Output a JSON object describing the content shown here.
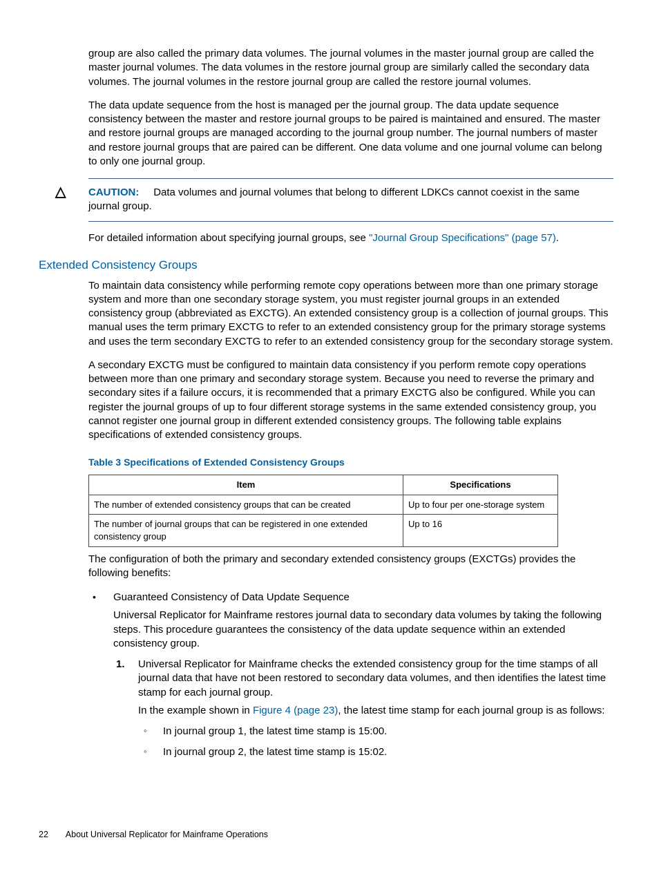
{
  "para": {
    "p1": "group are also called the primary data volumes. The journal volumes in the master journal group are called the master journal volumes. The data volumes in the restore journal group are similarly called the secondary data volumes. The journal volumes in the restore journal group are called the restore journal volumes.",
    "p2": "The data update sequence from the host is managed per the journal group. The data update sequence consistency between the master and restore journal groups to be paired is maintained and ensured. The master and restore journal groups are managed according to the journal group number. The journal numbers of master and restore journal groups that are paired can be different. One data volume and one journal volume can belong to only one journal group."
  },
  "caution": {
    "label": "CAUTION:",
    "text": "Data volumes and journal volumes that belong to different LDKCs cannot coexist in the same journal group.",
    "after_pre": "For detailed information about specifying journal groups, see ",
    "link": "\"Journal Group Specifications\" (page 57)",
    "after_post": "."
  },
  "section": {
    "heading": "Extended Consistency Groups",
    "p1": "To maintain data consistency while performing remote copy operations between more than one primary storage system and more than one secondary storage system, you must register journal groups in an extended consistency group (abbreviated as EXCTG). An extended consistency group is a collection of journal groups. This manual uses the term primary EXCTG to refer to an extended consistency group for the primary storage systems and uses the term secondary EXCTG to refer to an extended consistency group for the secondary storage system.",
    "p2": "A secondary EXCTG must be configured to maintain data consistency if you perform remote copy operations between more than one primary and secondary storage system. Because you need to reverse the primary and secondary sites if a failure occurs, it is recommended that a primary EXCTG also be configured. While you can register the journal groups of up to four different storage systems in the same extended consistency group, you cannot register one journal group in different extended consistency groups. The following table explains specifications of extended consistency groups."
  },
  "table": {
    "caption": "Table 3 Specifications of Extended Consistency Groups",
    "head": {
      "c1": "Item",
      "c2": "Specifications"
    },
    "rows": [
      {
        "c1": "The number of extended consistency groups that can be created",
        "c2": "Up to four per one-storage system"
      },
      {
        "c1": "The number of journal groups that can be registered in one extended consistency group",
        "c2": "Up to 16"
      }
    ]
  },
  "after_table": "The configuration of both the primary and secondary extended consistency groups (EXCTGs) provides the following benefits:",
  "bullet": {
    "title": "Guaranteed Consistency of Data Update Sequence",
    "body": "Universal Replicator for Mainframe restores journal data to secondary data volumes by taking the following steps. This procedure guarantees the consistency of the data update sequence within an extended consistency group."
  },
  "step1": {
    "num": "1.",
    "text": "Universal Replicator for Mainframe checks the extended consistency group for the time stamps of all journal data that have not been restored to secondary data volumes, and then identifies the latest time stamp for each journal group.",
    "example_pre": "In the example shown in ",
    "example_link": "Figure 4 (page 23)",
    "example_post": ", the latest time stamp for each journal group is as follows:",
    "sub": [
      "In journal group 1, the latest time stamp is 15:00.",
      "In journal group 2, the latest time stamp is 15:02."
    ]
  },
  "footer": {
    "page": "22",
    "title": "About Universal Replicator for Mainframe Operations"
  }
}
